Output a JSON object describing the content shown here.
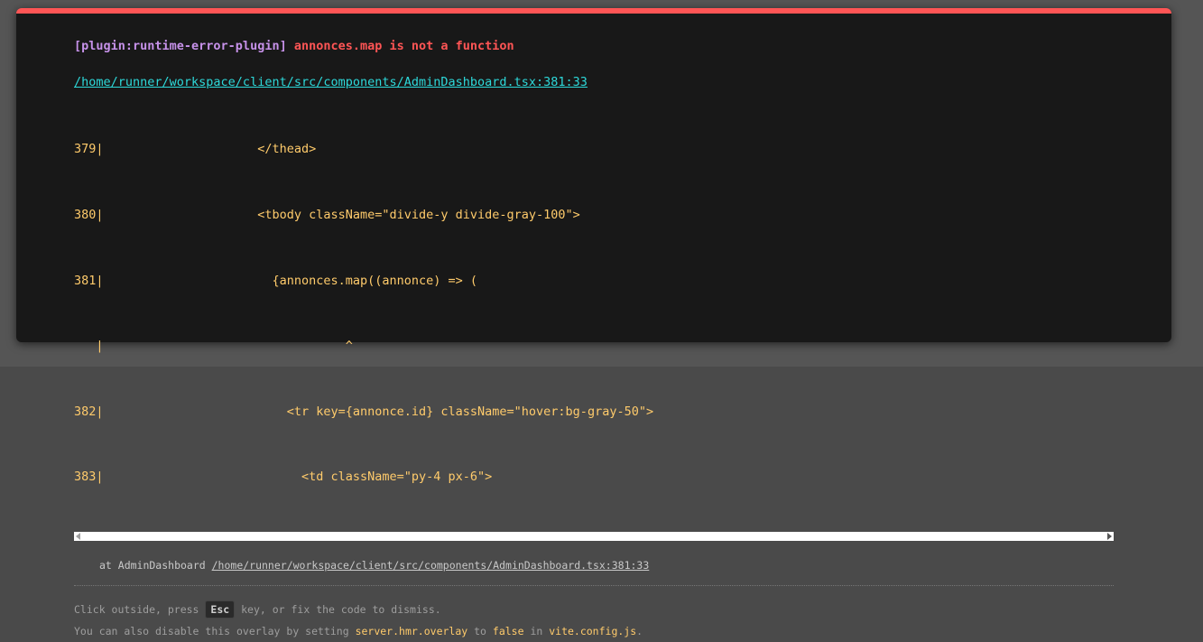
{
  "error": {
    "plugin": "[plugin:runtime-error-plugin]",
    "message": "annonces.map is not a function",
    "file": "/home/runner/workspace/client/src/components/AdminDashboard.tsx:381:33"
  },
  "frame_lines": [
    "379|                     </thead>",
    "380|                     <tbody className=\"divide-y divide-gray-100\">",
    "381|                       {annonces.map((annonce) => (",
    "   |                                 ^",
    "382|                         <tr key={annonce.id} className=\"hover:bg-gray-50\">",
    "383|                           <td className=\"py-4 px-6\">"
  ],
  "stack": {
    "prefix": "at AdminDashboard ",
    "file": "/home/runner/workspace/client/src/components/AdminDashboard.tsx:381:33"
  },
  "tip": {
    "line1_before": "Click outside, press ",
    "key": "Esc",
    "line1_after": " key, or fix the code to dismiss.",
    "line2_before": "You can also disable this overlay by setting ",
    "setting": "server.hmr.overlay",
    "line2_mid": " to ",
    "value": "false",
    "line2_in": " in ",
    "config_file": "vite.config.js",
    "line2_end": "."
  },
  "colors": {
    "accent_red": "#ff5555",
    "plugin_purple": "#c792ea",
    "link_cyan": "#2dd9da",
    "code_yellow": "#ffcb6b"
  }
}
